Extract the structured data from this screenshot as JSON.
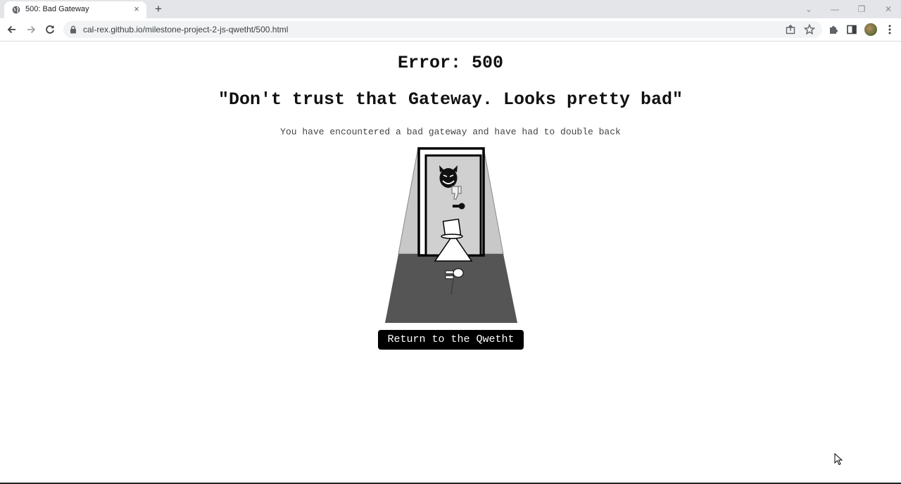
{
  "browser": {
    "tab_title": "500: Bad Gateway",
    "tab_close": "×",
    "new_tab": "+",
    "url": "cal-rex.github.io/milestone-project-2-js-qwetht/500.html",
    "window_controls": {
      "minimize": "—",
      "restore": "❐",
      "close": "✕"
    },
    "icons": [
      "globe-icon",
      "back-icon",
      "forward-icon",
      "reload-icon",
      "lock-icon",
      "share-icon",
      "star-icon",
      "extensions-icon",
      "side-panel-icon",
      "profile-avatar",
      "menu-icon"
    ]
  },
  "page": {
    "error_title": "Error: 500",
    "quote": "\"Don't trust that Gateway. Looks pretty bad\"",
    "subtitle": "You have encountered a bad gateway and have had to double back",
    "return_button": "Return to the Qwetht"
  },
  "colors": {
    "button_bg": "#000000",
    "button_text": "#ffffff",
    "wall_gray": "#c8c8c8",
    "floor_gray": "#555555"
  }
}
